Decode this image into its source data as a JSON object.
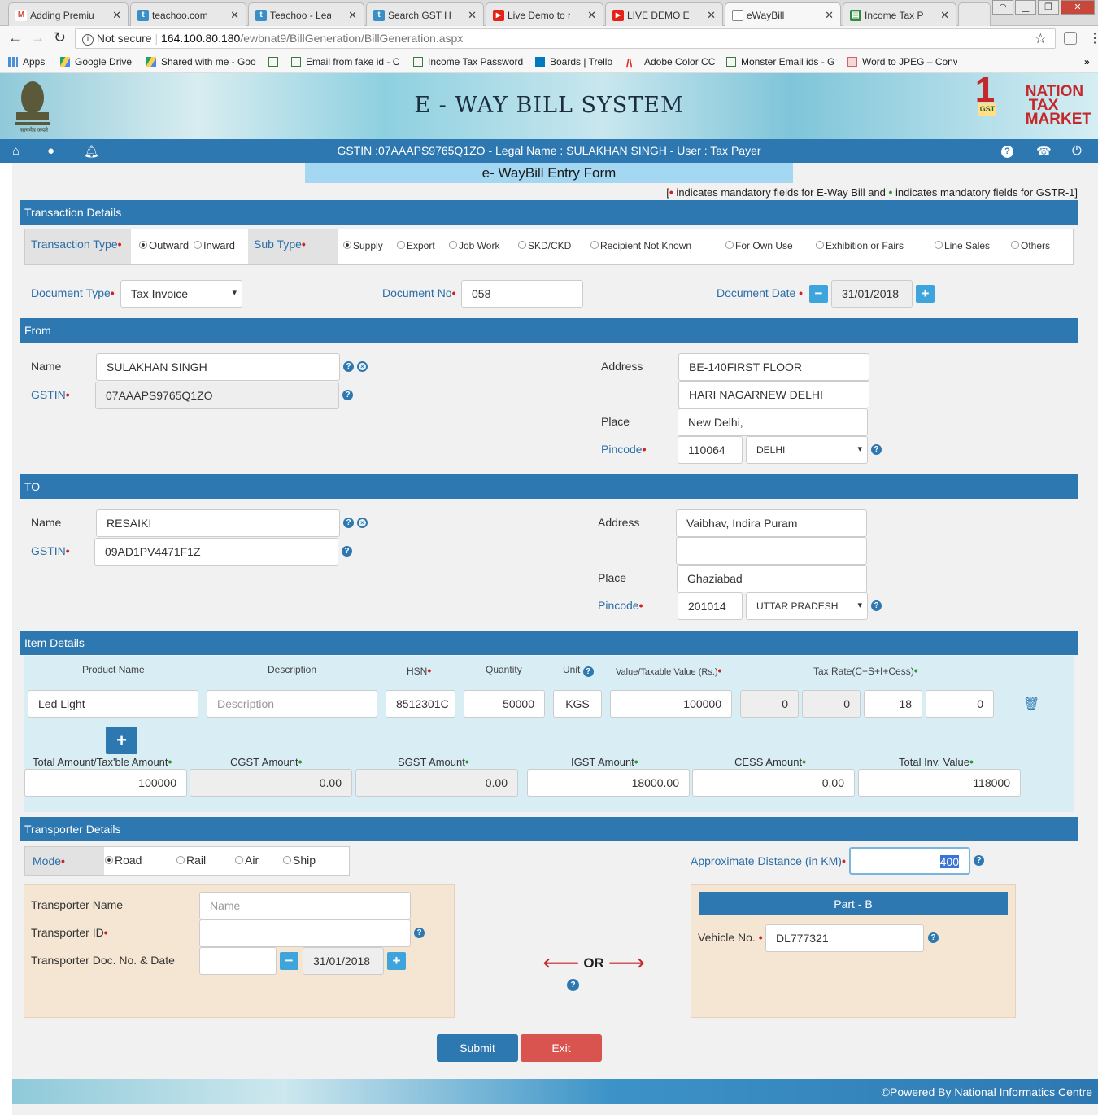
{
  "browser": {
    "tabs": [
      {
        "title": "Adding Premiu",
        "icon": "gmail-icon",
        "color": "#d44638",
        "glyph": "M"
      },
      {
        "title": "teachoo.com",
        "icon": "teachoo-icon",
        "color": "#3a8fc7",
        "glyph": "t"
      },
      {
        "title": "Teachoo - Learn",
        "icon": "teachoo-icon",
        "color": "#3a8fc7",
        "glyph": "t"
      },
      {
        "title": "Search GST HSN",
        "icon": "teachoo-icon",
        "color": "#3a8fc7",
        "glyph": "t"
      },
      {
        "title": "Live Demo to re",
        "icon": "youtube-icon",
        "color": "#e62117",
        "glyph": "▶"
      },
      {
        "title": "LIVE DEMO E-W",
        "icon": "youtube-icon",
        "color": "#e62117",
        "glyph": "▶"
      },
      {
        "title": "eWayBill",
        "icon": "page-icon",
        "color": "#888",
        "glyph": ""
      },
      {
        "title": "Income Tax Pas",
        "icon": "sheet-icon",
        "color": "#2e8b3e",
        "glyph": "▤"
      }
    ],
    "security": "Not secure",
    "url_host": "164.100.80.180",
    "url_path": "/ewbnat9/BillGeneration/BillGeneration.aspx",
    "bookmarks": [
      "Apps",
      "Google Drive",
      "Shared with me - Goo",
      "",
      "Email from fake id - C",
      "Income Tax Password",
      "Boards | Trello",
      "Adobe Color CC",
      "Monster Email ids - G",
      "Word to JPEG – Conv"
    ]
  },
  "header": {
    "title": "E - WAY BILL SYSTEM",
    "brand_line1": "NATION",
    "brand_line2": "TAX",
    "brand_line3": "MARKET",
    "brand_badge": "GST",
    "emblem_caption": "सत्यमेव जयते",
    "user_info": "GSTIN :07AAAPS9765Q1ZO - Legal Name : SULAKHAN SINGH - User : Tax Payer"
  },
  "form": {
    "title": "e- WayBill Entry Form",
    "note_start": "[",
    "note_mid": " indicates mandatory fields for E-Way Bill and ",
    "note_end": " indicates mandatory fields for GSTR-1]",
    "transaction": {
      "section_label": "Transaction Details",
      "type_label": "Transaction Type",
      "outward": "Outward",
      "inward": "Inward",
      "subtype_label": "Sub Type",
      "subtypes": [
        "Supply",
        "Export",
        "Job Work",
        "SKD/CKD",
        "Recipient Not Known",
        "For Own Use",
        "Exhibition or Fairs",
        "Line Sales",
        "Others"
      ],
      "doc_type_label": "Document Type",
      "doc_type": "Tax Invoice",
      "doc_no_label": "Document No",
      "doc_no": "058",
      "doc_date_label": "Document Date",
      "doc_date": "31/01/2018"
    },
    "from": {
      "section_label": "From",
      "name_label": "Name",
      "name": "SULAKHAN  SINGH",
      "gstin_label": "GSTIN",
      "gstin": "07AAAPS9765Q1ZO",
      "address_label": "Address",
      "address1": "BE-140FIRST FLOOR",
      "address2": "HARI NAGARNEW DELHI",
      "place_label": "Place",
      "place": "New Delhi,",
      "pincode_label": "Pincode",
      "pincode": "110064",
      "state": "DELHI"
    },
    "to": {
      "section_label": "TO",
      "name_label": "Name",
      "name": "RESAIKI",
      "gstin_label": "GSTIN",
      "gstin": "09AD1PV4471F1Z",
      "address_label": "Address",
      "address1": "Vaibhav, Indira Puram",
      "address2": "",
      "place_label": "Place",
      "place": "Ghaziabad",
      "pincode_label": "Pincode",
      "pincode": "201014",
      "state": "UTTAR PRADESH"
    },
    "items": {
      "section_label": "Item Details",
      "headers": {
        "product": "Product Name",
        "description": "Description",
        "hsn": "HSN",
        "quantity": "Quantity",
        "unit": "Unit",
        "value": "Value/Taxable Value (Rs.)",
        "tax": "Tax Rate(C+S+I+Cess)"
      },
      "row": {
        "product": "Led Light",
        "description_placeholder": "Description",
        "hsn": "8512301C",
        "quantity": "50000",
        "unit": "KGS",
        "value": "100000",
        "cgst": "0",
        "sgst": "0",
        "igst": "18",
        "cess": "0"
      },
      "totals_labels": {
        "total": "Total Amount/Tax'ble Amount",
        "cgst": "CGST Amount",
        "sgst": "SGST Amount",
        "igst": "IGST Amount",
        "cess": "CESS Amount",
        "inv": "Total Inv. Value"
      },
      "totals": {
        "total": "100000",
        "cgst": "0.00",
        "sgst": "0.00",
        "igst": "18000.00",
        "cess": "0.00",
        "inv": "118000"
      }
    },
    "transporter": {
      "section_label": "Transporter Details",
      "mode_label": "Mode",
      "modes": [
        "Road",
        "Rail",
        "Air",
        "Ship"
      ],
      "distance_label": "Approximate Distance (in KM)",
      "distance": "400",
      "name_label": "Transporter Name",
      "name_placeholder": "Name",
      "id_label": "Transporter ID",
      "doc_label": "Transporter Doc. No. & Date",
      "doc_date": "31/01/2018",
      "or_text": "OR",
      "partb_label": "Part - B",
      "vehicle_label": "Vehicle No.",
      "vehicle": "DL777321"
    },
    "buttons": {
      "submit": "Submit",
      "exit": "Exit"
    },
    "footer": "©Powered By National Informatics Centre"
  }
}
